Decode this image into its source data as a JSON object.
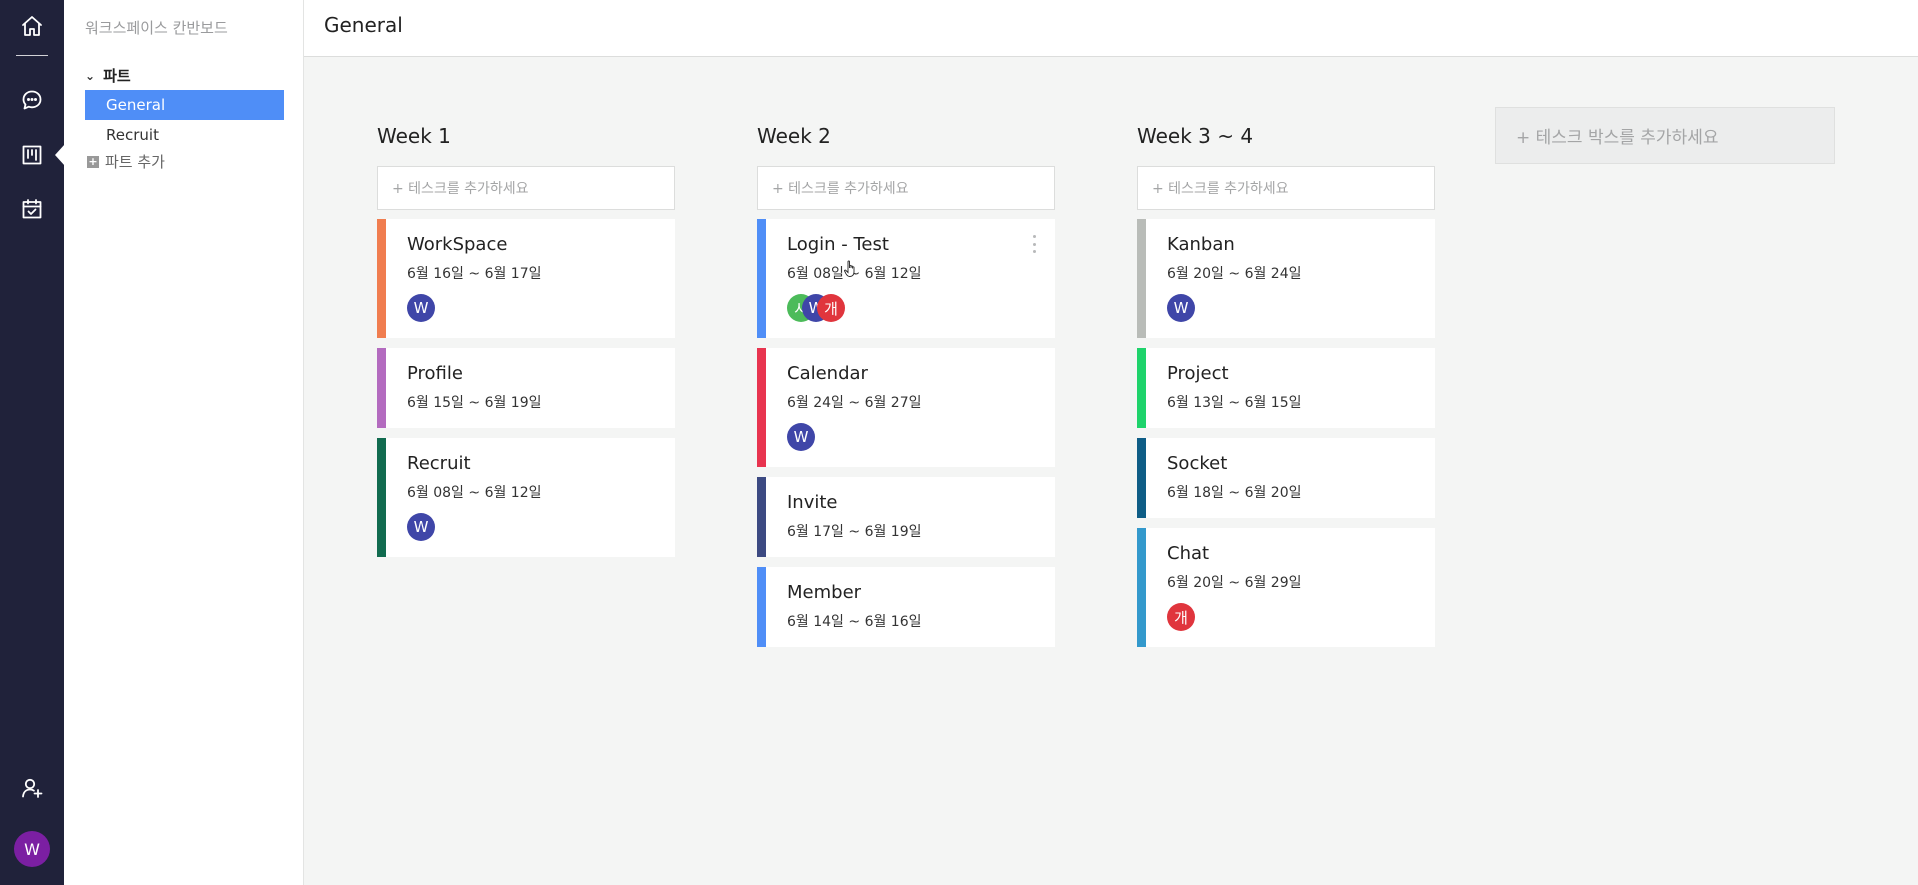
{
  "rail": {
    "icons": [
      "home-icon",
      "chat-icon",
      "kanban-icon",
      "calendar-icon",
      "add-user-icon"
    ],
    "avatar_initial": "W",
    "avatar_color": "#7b1fa2"
  },
  "side": {
    "title": "워크스페이스 칸반보드",
    "group_label": "파트",
    "items": [
      {
        "label": "General",
        "active": true
      },
      {
        "label": "Recruit",
        "active": false
      }
    ],
    "add_part_label": "파트 추가"
  },
  "header": {
    "title": "General"
  },
  "board": {
    "add_task_placeholder": "+ 테스크를 추가하세요",
    "add_box_label": "+ 테스크 박스를 추가하세요",
    "columns": [
      {
        "title": "Week 1",
        "cards": [
          {
            "title": "WorkSpace",
            "date": "6월 16일 ~ 6월 17일",
            "color": "#f07d4f",
            "avatars": [
              {
                "initial": "W",
                "color": "#3f46a8"
              }
            ]
          },
          {
            "title": "Profile",
            "date": "6월 15일 ~ 6월 19일",
            "color": "#b36bbf",
            "avatars": []
          },
          {
            "title": "Recruit",
            "date": "6월 08일 ~ 6월 12일",
            "color": "#116b4f",
            "avatars": [
              {
                "initial": "W",
                "color": "#3f46a8"
              }
            ]
          }
        ]
      },
      {
        "title": "Week 2",
        "cards": [
          {
            "title": "Login - Test",
            "date": "6월 08일 ~ 6월 12일",
            "color": "#4f8ef7",
            "menu": true,
            "avatars": [
              {
                "initial": "시",
                "color": "#4cbb5a"
              },
              {
                "initial": "W",
                "color": "#3f46a8"
              },
              {
                "initial": "개",
                "color": "#e0353d"
              }
            ]
          },
          {
            "title": "Calendar",
            "date": "6월 24일 ~ 6월 27일",
            "color": "#e8344f",
            "avatars": [
              {
                "initial": "W",
                "color": "#3f46a8"
              }
            ]
          },
          {
            "title": "Invite",
            "date": "6월 17일 ~ 6월 19일",
            "color": "#3c4a82",
            "avatars": []
          },
          {
            "title": "Member",
            "date": "6월 14일 ~ 6월 16일",
            "color": "#4f8ef7",
            "avatars": []
          }
        ]
      },
      {
        "title": "Week 3 ~ 4",
        "cards": [
          {
            "title": "Kanban",
            "date": "6월 20일 ~ 6월 24일",
            "color": "#b9bcb8",
            "avatars": [
              {
                "initial": "W",
                "color": "#3f46a8"
              }
            ]
          },
          {
            "title": "Project",
            "date": "6월 13일 ~ 6월 15일",
            "color": "#1ed36b",
            "avatars": []
          },
          {
            "title": "Socket",
            "date": "6월 18일 ~ 6월 20일",
            "color": "#0e5d86",
            "avatars": []
          },
          {
            "title": "Chat",
            "date": "6월 20일 ~ 6월 29일",
            "color": "#3399cc",
            "avatars": [
              {
                "initial": "개",
                "color": "#e0353d"
              }
            ]
          }
        ]
      }
    ]
  }
}
